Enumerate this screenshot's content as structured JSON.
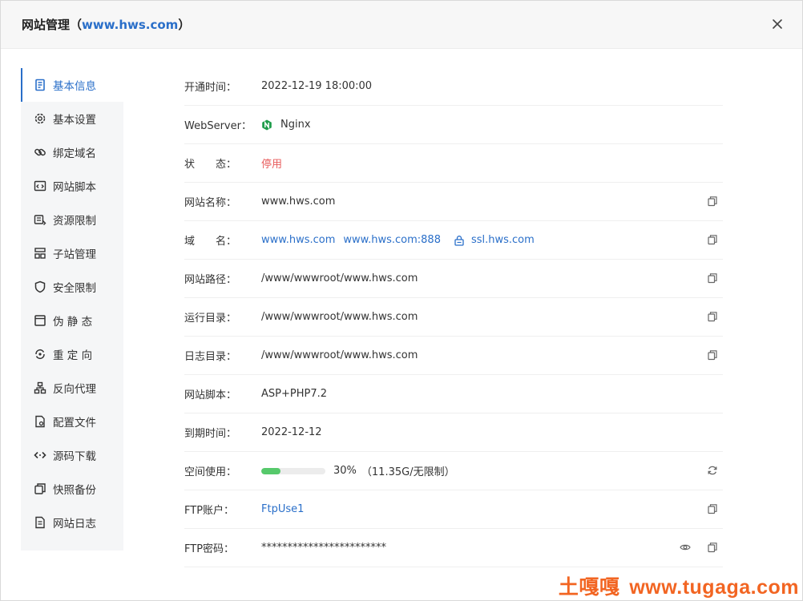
{
  "dialog": {
    "title_prefix": "网站管理（",
    "title_site": "www.hws.com",
    "title_suffix": "）",
    "close_label": "×"
  },
  "sidebar": {
    "items": [
      {
        "label": "基本信息",
        "icon": "document-icon",
        "active": true
      },
      {
        "label": "基本设置",
        "icon": "gear-icon",
        "active": false
      },
      {
        "label": "绑定域名",
        "icon": "link-icon",
        "active": false
      },
      {
        "label": "网站脚本",
        "icon": "code-window-icon",
        "active": false
      },
      {
        "label": "资源限制",
        "icon": "resource-icon",
        "active": false
      },
      {
        "label": "子站管理",
        "icon": "sitemap-icon",
        "active": false
      },
      {
        "label": "安全限制",
        "icon": "shield-icon",
        "active": false
      },
      {
        "label": "伪 静 态",
        "icon": "browser-icon",
        "active": false
      },
      {
        "label": "重 定 向",
        "icon": "redirect-icon",
        "active": false
      },
      {
        "label": "反向代理",
        "icon": "network-icon",
        "active": false
      },
      {
        "label": "配置文件",
        "icon": "config-file-icon",
        "active": false
      },
      {
        "label": "源码下载",
        "icon": "code-icon",
        "active": false
      },
      {
        "label": "快照备份",
        "icon": "copy-icon",
        "active": false
      },
      {
        "label": "网站日志",
        "icon": "log-icon",
        "active": false
      }
    ]
  },
  "info": {
    "open_time": {
      "label": "开通时间：",
      "value": "2022-12-19 18:00:00"
    },
    "webserver": {
      "label": "WebServer：",
      "value": "Nginx",
      "icon": "nginx-icon"
    },
    "status": {
      "label": "状　　态：",
      "value": "停用",
      "color": "#e85c5c"
    },
    "site_name": {
      "label": "网站名称：",
      "value": "www.hws.com"
    },
    "domain": {
      "label": "域　　名：",
      "values": [
        "www.hws.com",
        "www.hws.com:888"
      ],
      "ssl": "ssl.hws.com"
    },
    "site_path": {
      "label": "网站路径：",
      "value": "/www/wwwroot/www.hws.com"
    },
    "run_dir": {
      "label": "运行目录：",
      "value": "/www/wwwroot/www.hws.com"
    },
    "log_dir": {
      "label": "日志目录：",
      "value": "/www/wwwroot/www.hws.com"
    },
    "script": {
      "label": "网站脚本：",
      "value": "ASP+PHP7.2"
    },
    "expire": {
      "label": "到期时间：",
      "value": "2022-12-12"
    },
    "space": {
      "label": "空间使用：",
      "percent_text": "30%",
      "detail": "（11.35G/无限制）",
      "fill_percent": 30
    },
    "ftp_account": {
      "label": "FTP账户：",
      "value": "FtpUse1"
    },
    "ftp_password": {
      "label": "FTP密码：",
      "value": "************************"
    }
  },
  "colors": {
    "accent": "#2a6fc9",
    "danger": "#e85c5c",
    "progress": "#56c96b",
    "watermark": "#f26522"
  },
  "watermark": {
    "brand": "土嘎嘎",
    "url": "www.tugaga.com"
  }
}
